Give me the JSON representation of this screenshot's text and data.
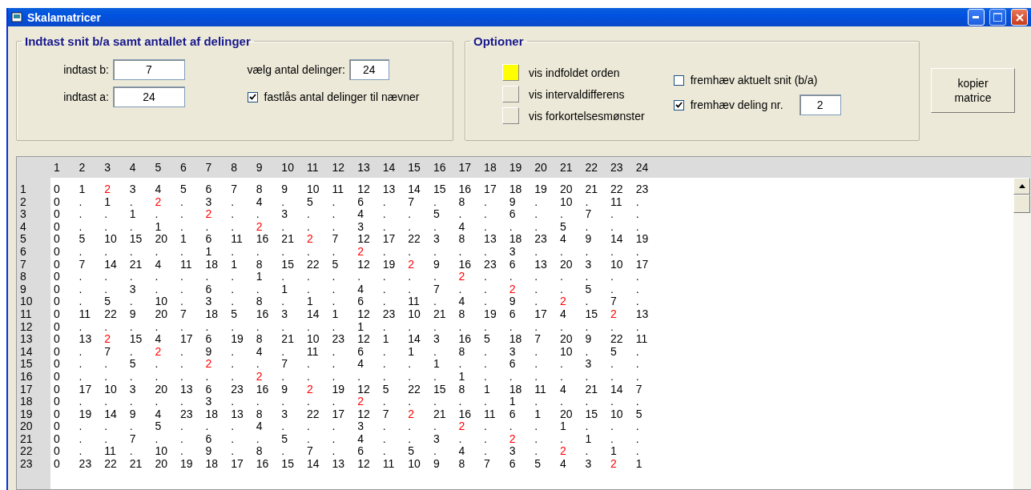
{
  "window": {
    "title": "Skalamatricer"
  },
  "input_group": {
    "title": "Indtast snit b/a samt antallet af delinger",
    "field_b": {
      "label": "indtast b:",
      "value": "7"
    },
    "field_a": {
      "label": "indtast a:",
      "value": "24"
    },
    "divisions": {
      "label": "vælg antal delinger:",
      "value": "24"
    },
    "lock_checkbox": {
      "label": "fastlås antal delinger til nævner",
      "checked": true
    }
  },
  "options_group": {
    "title": "Optioner",
    "toggles": [
      {
        "label": "vis indfoldet orden",
        "selected": true
      },
      {
        "label": "vis intervaldifferens",
        "selected": false
      },
      {
        "label": "vis forkortelsesmønster",
        "selected": false
      }
    ],
    "highlight_current": {
      "label": "fremhæv aktuelt snit (b/a)",
      "checked": false
    },
    "highlight_division": {
      "label": "fremhæv deling nr.",
      "checked": true,
      "value": "2"
    }
  },
  "copy_button": {
    "label": "kopier matrice"
  },
  "matrix": {
    "columns": [
      "1",
      "2",
      "3",
      "4",
      "5",
      "6",
      "7",
      "8",
      "9",
      "10",
      "11",
      "12",
      "13",
      "14",
      "15",
      "16",
      "17",
      "18",
      "19",
      "20",
      "21",
      "22",
      "23",
      "24"
    ],
    "rows": [
      {
        "label": "1",
        "cells": [
          "0",
          "1",
          "2",
          "3",
          "4",
          "5",
          "6",
          "7",
          "8",
          "9",
          "10",
          "11",
          "12",
          "13",
          "14",
          "15",
          "16",
          "17",
          "18",
          "19",
          "20",
          "21",
          "22",
          "23"
        ],
        "highlighted": [
          false,
          false,
          true,
          false,
          false,
          false,
          false,
          false,
          false,
          false,
          false,
          false,
          false,
          false,
          false,
          false,
          false,
          false,
          false,
          false,
          false,
          false,
          false,
          false
        ]
      },
      {
        "label": "2",
        "cells": [
          "0",
          ".",
          "1",
          ".",
          "2",
          ".",
          "3",
          ".",
          "4",
          ".",
          "5",
          ".",
          "6",
          ".",
          "7",
          ".",
          "8",
          ".",
          "9",
          ".",
          "10",
          ".",
          "11",
          "."
        ],
        "highlighted": [
          false,
          false,
          false,
          false,
          true,
          false,
          false,
          false,
          false,
          false,
          false,
          false,
          false,
          false,
          false,
          false,
          false,
          false,
          false,
          false,
          false,
          false,
          false,
          false
        ]
      },
      {
        "label": "3",
        "cells": [
          "0",
          ".",
          ".",
          "1",
          ".",
          ".",
          "2",
          ".",
          ".",
          "3",
          ".",
          ".",
          "4",
          ".",
          ".",
          "5",
          ".",
          ".",
          "6",
          ".",
          ".",
          "7",
          ".",
          "."
        ],
        "highlighted": [
          false,
          false,
          false,
          false,
          false,
          false,
          true,
          false,
          false,
          false,
          false,
          false,
          false,
          false,
          false,
          false,
          false,
          false,
          false,
          false,
          false,
          false,
          false,
          false
        ]
      },
      {
        "label": "4",
        "cells": [
          "0",
          ".",
          ".",
          ".",
          "1",
          ".",
          ".",
          ".",
          "2",
          ".",
          ".",
          ".",
          "3",
          ".",
          ".",
          ".",
          "4",
          ".",
          ".",
          ".",
          "5",
          ".",
          ".",
          "."
        ],
        "highlighted": [
          false,
          false,
          false,
          false,
          false,
          false,
          false,
          false,
          true,
          false,
          false,
          false,
          false,
          false,
          false,
          false,
          false,
          false,
          false,
          false,
          false,
          false,
          false,
          false
        ]
      },
      {
        "label": "5",
        "cells": [
          "0",
          "5",
          "10",
          "15",
          "20",
          "1",
          "6",
          "11",
          "16",
          "21",
          "2",
          "7",
          "12",
          "17",
          "22",
          "3",
          "8",
          "13",
          "18",
          "23",
          "4",
          "9",
          "14",
          "19"
        ],
        "highlighted": [
          false,
          false,
          false,
          false,
          false,
          false,
          false,
          false,
          false,
          false,
          true,
          false,
          false,
          false,
          false,
          false,
          false,
          false,
          false,
          false,
          false,
          false,
          false,
          false
        ]
      },
      {
        "label": "6",
        "cells": [
          "0",
          ".",
          ".",
          ".",
          ".",
          ".",
          "1",
          ".",
          ".",
          ".",
          ".",
          ".",
          "2",
          ".",
          ".",
          ".",
          ".",
          ".",
          "3",
          ".",
          ".",
          ".",
          ".",
          "."
        ],
        "highlighted": [
          false,
          false,
          false,
          false,
          false,
          false,
          false,
          false,
          false,
          false,
          false,
          false,
          true,
          false,
          false,
          false,
          false,
          false,
          false,
          false,
          false,
          false,
          false,
          false
        ]
      },
      {
        "label": "7",
        "cells": [
          "0",
          "7",
          "14",
          "21",
          "4",
          "11",
          "18",
          "1",
          "8",
          "15",
          "22",
          "5",
          "12",
          "19",
          "2",
          "9",
          "16",
          "23",
          "6",
          "13",
          "20",
          "3",
          "10",
          "17"
        ],
        "highlighted": [
          false,
          false,
          false,
          false,
          false,
          false,
          false,
          false,
          false,
          false,
          false,
          false,
          false,
          false,
          true,
          false,
          false,
          false,
          false,
          false,
          false,
          false,
          false,
          false
        ]
      },
      {
        "label": "8",
        "cells": [
          "0",
          ".",
          ".",
          ".",
          ".",
          ".",
          ".",
          ".",
          "1",
          ".",
          ".",
          ".",
          ".",
          ".",
          ".",
          ".",
          "2",
          ".",
          ".",
          ".",
          ".",
          ".",
          ".",
          "."
        ],
        "highlighted": [
          false,
          false,
          false,
          false,
          false,
          false,
          false,
          false,
          false,
          false,
          false,
          false,
          false,
          false,
          false,
          false,
          true,
          false,
          false,
          false,
          false,
          false,
          false,
          false
        ]
      },
      {
        "label": "9",
        "cells": [
          "0",
          ".",
          ".",
          "3",
          ".",
          ".",
          "6",
          ".",
          ".",
          "1",
          ".",
          ".",
          "4",
          ".",
          ".",
          "7",
          ".",
          ".",
          "2",
          ".",
          ".",
          "5",
          ".",
          "."
        ],
        "highlighted": [
          false,
          false,
          false,
          false,
          false,
          false,
          false,
          false,
          false,
          false,
          false,
          false,
          false,
          false,
          false,
          false,
          false,
          false,
          true,
          false,
          false,
          false,
          false,
          false
        ]
      },
      {
        "label": "10",
        "cells": [
          "0",
          ".",
          "5",
          ".",
          "10",
          ".",
          "3",
          ".",
          "8",
          ".",
          "1",
          ".",
          "6",
          ".",
          "11",
          ".",
          "4",
          ".",
          "9",
          ".",
          "2",
          ".",
          "7",
          "."
        ],
        "highlighted": [
          false,
          false,
          false,
          false,
          false,
          false,
          false,
          false,
          false,
          false,
          false,
          false,
          false,
          false,
          false,
          false,
          false,
          false,
          false,
          false,
          true,
          false,
          false,
          false
        ]
      },
      {
        "label": "11",
        "cells": [
          "0",
          "11",
          "22",
          "9",
          "20",
          "7",
          "18",
          "5",
          "16",
          "3",
          "14",
          "1",
          "12",
          "23",
          "10",
          "21",
          "8",
          "19",
          "6",
          "17",
          "4",
          "15",
          "2",
          "13"
        ],
        "highlighted": [
          false,
          false,
          false,
          false,
          false,
          false,
          false,
          false,
          false,
          false,
          false,
          false,
          false,
          false,
          false,
          false,
          false,
          false,
          false,
          false,
          false,
          false,
          true,
          false
        ]
      },
      {
        "label": "12",
        "cells": [
          "0",
          ".",
          ".",
          ".",
          ".",
          ".",
          ".",
          ".",
          ".",
          ".",
          ".",
          ".",
          "1",
          ".",
          ".",
          ".",
          ".",
          ".",
          ".",
          ".",
          ".",
          ".",
          ".",
          "."
        ],
        "highlighted": [
          false,
          false,
          false,
          false,
          false,
          false,
          false,
          false,
          false,
          false,
          false,
          false,
          false,
          false,
          false,
          false,
          false,
          false,
          false,
          false,
          false,
          false,
          false,
          false
        ]
      },
      {
        "label": "13",
        "cells": [
          "0",
          "13",
          "2",
          "15",
          "4",
          "17",
          "6",
          "19",
          "8",
          "21",
          "10",
          "23",
          "12",
          "1",
          "14",
          "3",
          "16",
          "5",
          "18",
          "7",
          "20",
          "9",
          "22",
          "11"
        ],
        "highlighted": [
          false,
          false,
          true,
          false,
          false,
          false,
          false,
          false,
          false,
          false,
          false,
          false,
          false,
          false,
          false,
          false,
          false,
          false,
          false,
          false,
          false,
          false,
          false,
          false
        ]
      },
      {
        "label": "14",
        "cells": [
          "0",
          ".",
          "7",
          ".",
          "2",
          ".",
          "9",
          ".",
          "4",
          ".",
          "11",
          ".",
          "6",
          ".",
          "1",
          ".",
          "8",
          ".",
          "3",
          ".",
          "10",
          ".",
          "5",
          "."
        ],
        "highlighted": [
          false,
          false,
          false,
          false,
          true,
          false,
          false,
          false,
          false,
          false,
          false,
          false,
          false,
          false,
          false,
          false,
          false,
          false,
          false,
          false,
          false,
          false,
          false,
          false
        ]
      },
      {
        "label": "15",
        "cells": [
          "0",
          ".",
          ".",
          "5",
          ".",
          ".",
          "2",
          ".",
          ".",
          "7",
          ".",
          ".",
          "4",
          ".",
          ".",
          "1",
          ".",
          ".",
          "6",
          ".",
          ".",
          "3",
          ".",
          "."
        ],
        "highlighted": [
          false,
          false,
          false,
          false,
          false,
          false,
          true,
          false,
          false,
          false,
          false,
          false,
          false,
          false,
          false,
          false,
          false,
          false,
          false,
          false,
          false,
          false,
          false,
          false
        ]
      },
      {
        "label": "16",
        "cells": [
          "0",
          ".",
          ".",
          ".",
          ".",
          ".",
          ".",
          ".",
          "2",
          ".",
          ".",
          ".",
          ".",
          ".",
          ".",
          ".",
          "1",
          ".",
          ".",
          ".",
          ".",
          ".",
          ".",
          "."
        ],
        "highlighted": [
          false,
          false,
          false,
          false,
          false,
          false,
          false,
          false,
          true,
          false,
          false,
          false,
          false,
          false,
          false,
          false,
          false,
          false,
          false,
          false,
          false,
          false,
          false,
          false
        ]
      },
      {
        "label": "17",
        "cells": [
          "0",
          "17",
          "10",
          "3",
          "20",
          "13",
          "6",
          "23",
          "16",
          "9",
          "2",
          "19",
          "12",
          "5",
          "22",
          "15",
          "8",
          "1",
          "18",
          "11",
          "4",
          "21",
          "14",
          "7"
        ],
        "highlighted": [
          false,
          false,
          false,
          false,
          false,
          false,
          false,
          false,
          false,
          false,
          true,
          false,
          false,
          false,
          false,
          false,
          false,
          false,
          false,
          false,
          false,
          false,
          false,
          false
        ]
      },
      {
        "label": "18",
        "cells": [
          "0",
          ".",
          ".",
          ".",
          ".",
          ".",
          "3",
          ".",
          ".",
          ".",
          ".",
          ".",
          "2",
          ".",
          ".",
          ".",
          ".",
          ".",
          "1",
          ".",
          ".",
          ".",
          ".",
          "."
        ],
        "highlighted": [
          false,
          false,
          false,
          false,
          false,
          false,
          false,
          false,
          false,
          false,
          false,
          false,
          true,
          false,
          false,
          false,
          false,
          false,
          false,
          false,
          false,
          false,
          false,
          false
        ]
      },
      {
        "label": "19",
        "cells": [
          "0",
          "19",
          "14",
          "9",
          "4",
          "23",
          "18",
          "13",
          "8",
          "3",
          "22",
          "17",
          "12",
          "7",
          "2",
          "21",
          "16",
          "11",
          "6",
          "1",
          "20",
          "15",
          "10",
          "5"
        ],
        "highlighted": [
          false,
          false,
          false,
          false,
          false,
          false,
          false,
          false,
          false,
          false,
          false,
          false,
          false,
          false,
          true,
          false,
          false,
          false,
          false,
          false,
          false,
          false,
          false,
          false
        ]
      },
      {
        "label": "20",
        "cells": [
          "0",
          ".",
          ".",
          ".",
          "5",
          ".",
          ".",
          ".",
          "4",
          ".",
          ".",
          ".",
          "3",
          ".",
          ".",
          ".",
          "2",
          ".",
          ".",
          ".",
          "1",
          ".",
          ".",
          "."
        ],
        "highlighted": [
          false,
          false,
          false,
          false,
          false,
          false,
          false,
          false,
          false,
          false,
          false,
          false,
          false,
          false,
          false,
          false,
          true,
          false,
          false,
          false,
          false,
          false,
          false,
          false
        ]
      },
      {
        "label": "21",
        "cells": [
          "0",
          ".",
          ".",
          "7",
          ".",
          ".",
          "6",
          ".",
          ".",
          "5",
          ".",
          ".",
          "4",
          ".",
          ".",
          "3",
          ".",
          ".",
          "2",
          ".",
          ".",
          "1",
          ".",
          "."
        ],
        "highlighted": [
          false,
          false,
          false,
          false,
          false,
          false,
          false,
          false,
          false,
          false,
          false,
          false,
          false,
          false,
          false,
          false,
          false,
          false,
          true,
          false,
          false,
          false,
          false,
          false
        ]
      },
      {
        "label": "22",
        "cells": [
          "0",
          ".",
          "11",
          ".",
          "10",
          ".",
          "9",
          ".",
          "8",
          ".",
          "7",
          ".",
          "6",
          ".",
          "5",
          ".",
          "4",
          ".",
          "3",
          ".",
          "2",
          ".",
          "1",
          "."
        ],
        "highlighted": [
          false,
          false,
          false,
          false,
          false,
          false,
          false,
          false,
          false,
          false,
          false,
          false,
          false,
          false,
          false,
          false,
          false,
          false,
          false,
          false,
          true,
          false,
          false,
          false
        ]
      },
      {
        "label": "23",
        "cells": [
          "0",
          "23",
          "22",
          "21",
          "20",
          "19",
          "18",
          "17",
          "16",
          "15",
          "14",
          "13",
          "12",
          "11",
          "10",
          "9",
          "8",
          "7",
          "6",
          "5",
          "4",
          "3",
          "2",
          "1"
        ],
        "highlighted": [
          false,
          false,
          false,
          false,
          false,
          false,
          false,
          false,
          false,
          false,
          false,
          false,
          false,
          false,
          false,
          false,
          false,
          false,
          false,
          false,
          false,
          false,
          true,
          false
        ]
      }
    ]
  }
}
